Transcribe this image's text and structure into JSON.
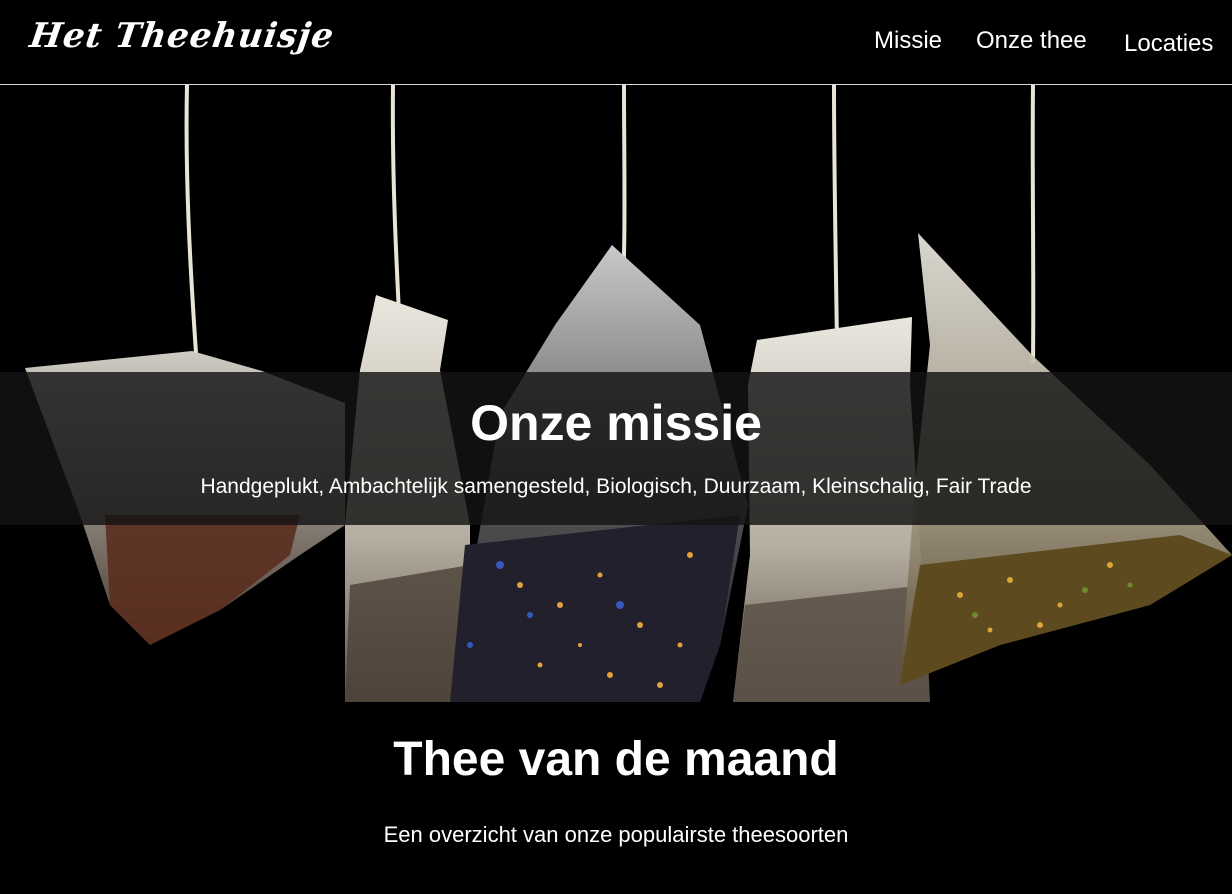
{
  "header": {
    "logo": "Het Theehuisje",
    "nav": [
      {
        "label": "Missie"
      },
      {
        "label": "Onze thee"
      },
      {
        "label": "Locaties"
      }
    ]
  },
  "mission": {
    "title": "Onze missie",
    "text": "Handgeplukt, Ambachtelijk samengesteld, Biologisch, Duurzaam, Kleinschalig, Fair Trade"
  },
  "month": {
    "title": "Thee van de maand",
    "subtitle": "Een overzicht van onze populairste theesoorten"
  }
}
